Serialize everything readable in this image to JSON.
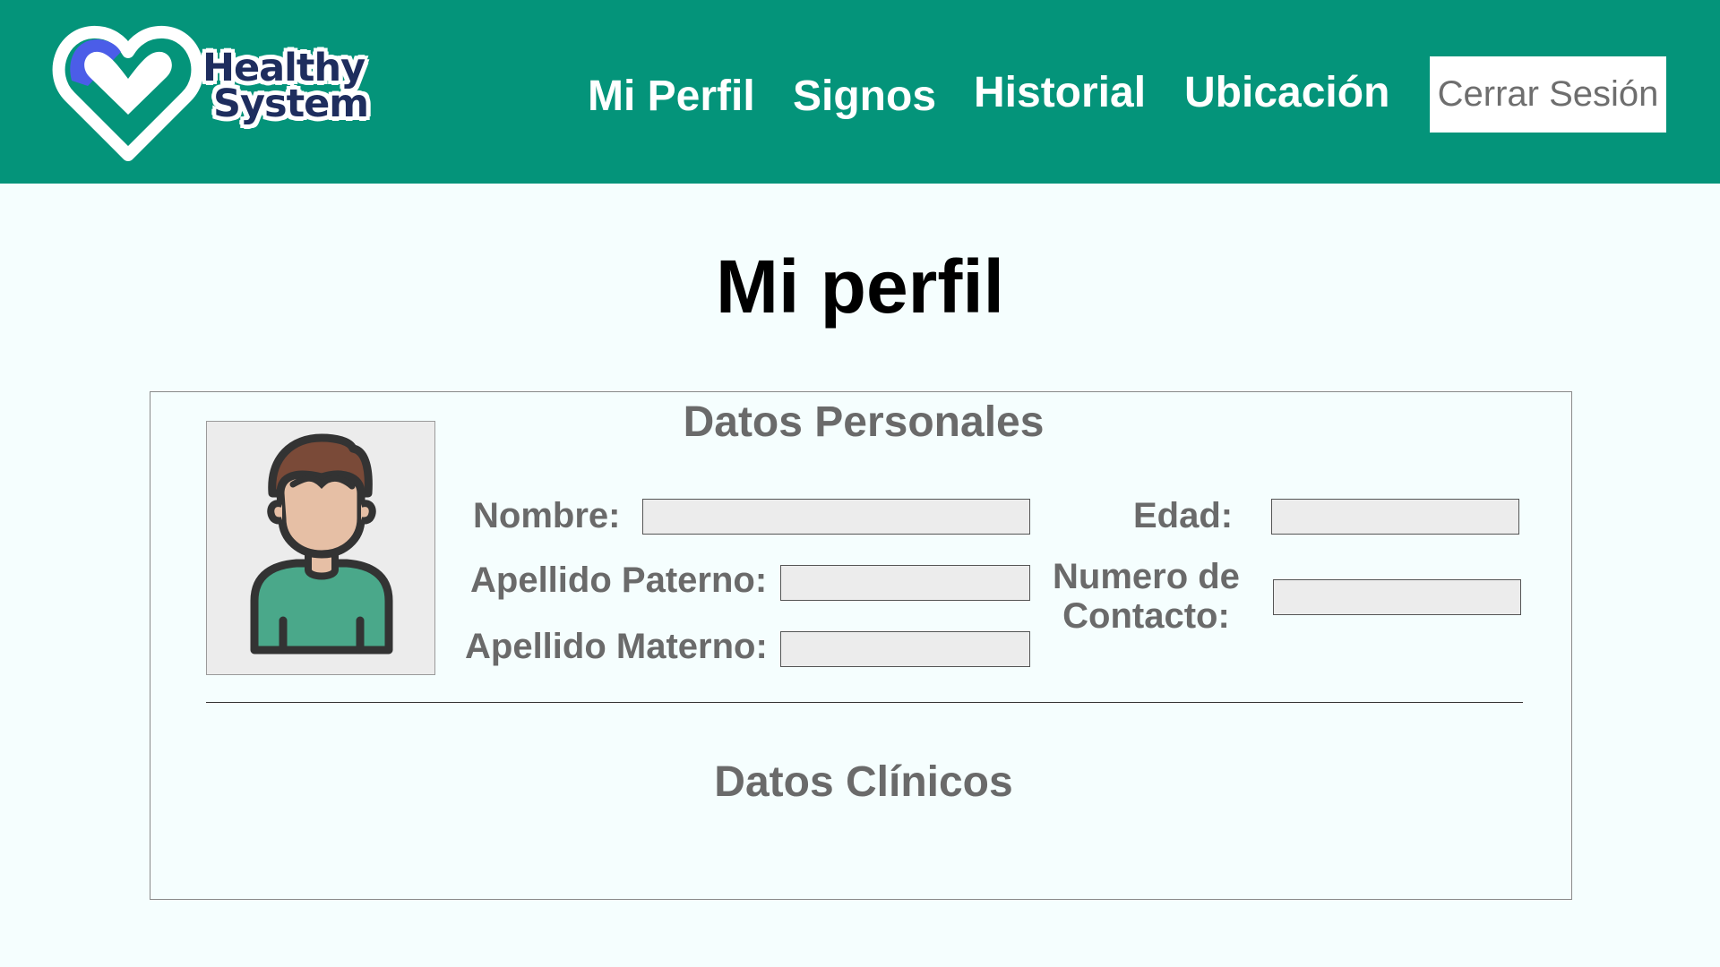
{
  "header": {
    "logo": {
      "line1": "Healthy",
      "line2": "System"
    },
    "nav": [
      {
        "label": "Mi Perfil"
      },
      {
        "label": "Signos"
      },
      {
        "label": "Historial"
      },
      {
        "label": "Ubicación"
      }
    ],
    "logout_label": "Cerrar Sesión"
  },
  "main": {
    "title": "Mi perfil",
    "personal": {
      "section_title": "Datos Personales",
      "fields": {
        "nombre": {
          "label": "Nombre:",
          "value": ""
        },
        "apellido_paterno": {
          "label": "Apellido Paterno:",
          "value": ""
        },
        "apellido_materno": {
          "label": "Apellido Materno:",
          "value": ""
        },
        "edad": {
          "label": "Edad:",
          "value": ""
        },
        "contacto": {
          "label_line1": "Numero de",
          "label_line2": "Contacto:",
          "value": ""
        }
      }
    },
    "clinical": {
      "section_title": "Datos Clínicos"
    }
  },
  "colors": {
    "header_bg": "#04947a",
    "page_bg": "#f5fefe",
    "label_gray": "#6a6a6a",
    "input_bg": "#ececec",
    "logo_navy": "#1e2d5e",
    "logo_blue": "#4b5de8",
    "avatar_shirt": "#4aa88a",
    "avatar_hair": "#7a4a38",
    "avatar_skin": "#e6bfa5"
  },
  "icons": {
    "logo": "heart-check-logo",
    "avatar": "user-avatar-icon"
  }
}
